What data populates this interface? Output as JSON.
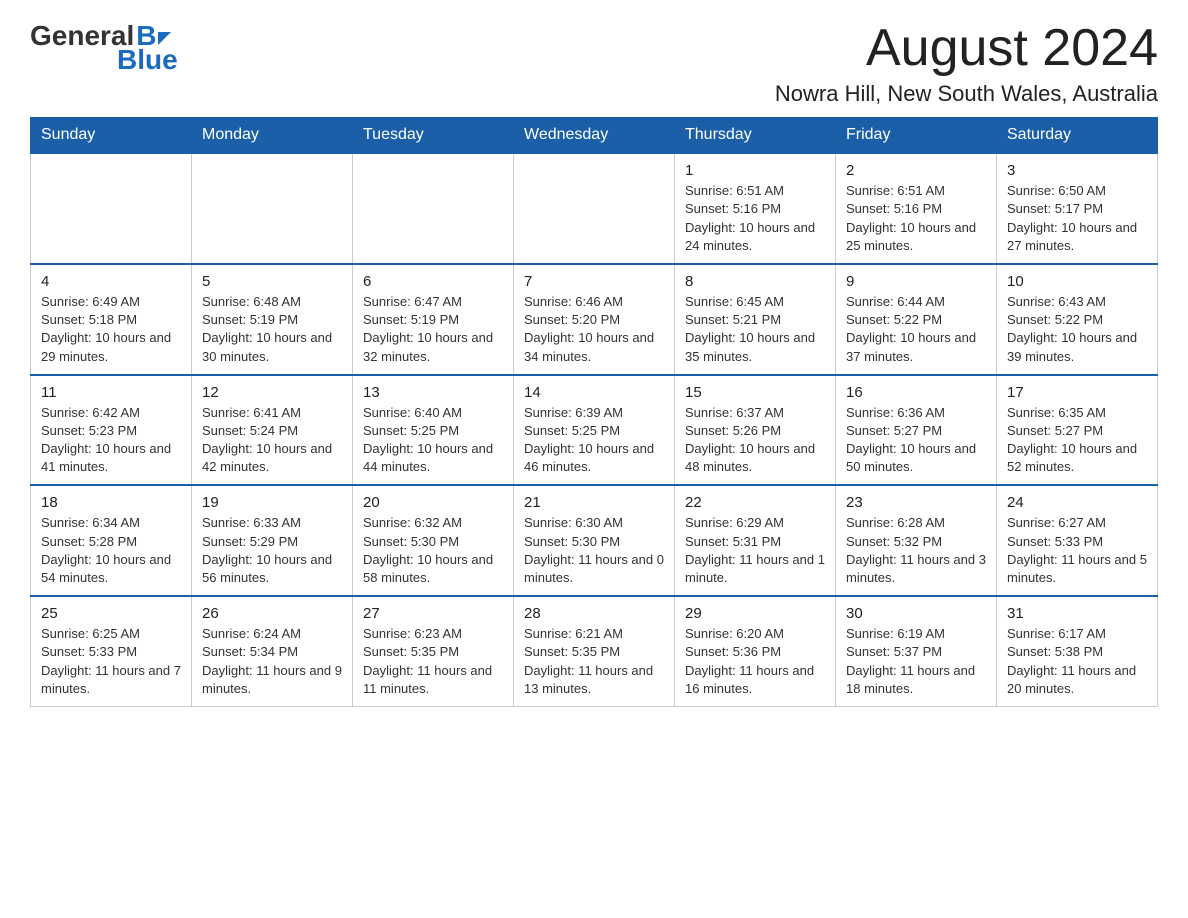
{
  "logo": {
    "general": "General",
    "blue": "Blue"
  },
  "header": {
    "month_year": "August 2024",
    "location": "Nowra Hill, New South Wales, Australia"
  },
  "days_of_week": [
    "Sunday",
    "Monday",
    "Tuesday",
    "Wednesday",
    "Thursday",
    "Friday",
    "Saturday"
  ],
  "weeks": [
    {
      "days": [
        {
          "date": "",
          "info": ""
        },
        {
          "date": "",
          "info": ""
        },
        {
          "date": "",
          "info": ""
        },
        {
          "date": "",
          "info": ""
        },
        {
          "date": "1",
          "info": "Sunrise: 6:51 AM\nSunset: 5:16 PM\nDaylight: 10 hours and 24 minutes."
        },
        {
          "date": "2",
          "info": "Sunrise: 6:51 AM\nSunset: 5:16 PM\nDaylight: 10 hours and 25 minutes."
        },
        {
          "date": "3",
          "info": "Sunrise: 6:50 AM\nSunset: 5:17 PM\nDaylight: 10 hours and 27 minutes."
        }
      ]
    },
    {
      "days": [
        {
          "date": "4",
          "info": "Sunrise: 6:49 AM\nSunset: 5:18 PM\nDaylight: 10 hours and 29 minutes."
        },
        {
          "date": "5",
          "info": "Sunrise: 6:48 AM\nSunset: 5:19 PM\nDaylight: 10 hours and 30 minutes."
        },
        {
          "date": "6",
          "info": "Sunrise: 6:47 AM\nSunset: 5:19 PM\nDaylight: 10 hours and 32 minutes."
        },
        {
          "date": "7",
          "info": "Sunrise: 6:46 AM\nSunset: 5:20 PM\nDaylight: 10 hours and 34 minutes."
        },
        {
          "date": "8",
          "info": "Sunrise: 6:45 AM\nSunset: 5:21 PM\nDaylight: 10 hours and 35 minutes."
        },
        {
          "date": "9",
          "info": "Sunrise: 6:44 AM\nSunset: 5:22 PM\nDaylight: 10 hours and 37 minutes."
        },
        {
          "date": "10",
          "info": "Sunrise: 6:43 AM\nSunset: 5:22 PM\nDaylight: 10 hours and 39 minutes."
        }
      ]
    },
    {
      "days": [
        {
          "date": "11",
          "info": "Sunrise: 6:42 AM\nSunset: 5:23 PM\nDaylight: 10 hours and 41 minutes."
        },
        {
          "date": "12",
          "info": "Sunrise: 6:41 AM\nSunset: 5:24 PM\nDaylight: 10 hours and 42 minutes."
        },
        {
          "date": "13",
          "info": "Sunrise: 6:40 AM\nSunset: 5:25 PM\nDaylight: 10 hours and 44 minutes."
        },
        {
          "date": "14",
          "info": "Sunrise: 6:39 AM\nSunset: 5:25 PM\nDaylight: 10 hours and 46 minutes."
        },
        {
          "date": "15",
          "info": "Sunrise: 6:37 AM\nSunset: 5:26 PM\nDaylight: 10 hours and 48 minutes."
        },
        {
          "date": "16",
          "info": "Sunrise: 6:36 AM\nSunset: 5:27 PM\nDaylight: 10 hours and 50 minutes."
        },
        {
          "date": "17",
          "info": "Sunrise: 6:35 AM\nSunset: 5:27 PM\nDaylight: 10 hours and 52 minutes."
        }
      ]
    },
    {
      "days": [
        {
          "date": "18",
          "info": "Sunrise: 6:34 AM\nSunset: 5:28 PM\nDaylight: 10 hours and 54 minutes."
        },
        {
          "date": "19",
          "info": "Sunrise: 6:33 AM\nSunset: 5:29 PM\nDaylight: 10 hours and 56 minutes."
        },
        {
          "date": "20",
          "info": "Sunrise: 6:32 AM\nSunset: 5:30 PM\nDaylight: 10 hours and 58 minutes."
        },
        {
          "date": "21",
          "info": "Sunrise: 6:30 AM\nSunset: 5:30 PM\nDaylight: 11 hours and 0 minutes."
        },
        {
          "date": "22",
          "info": "Sunrise: 6:29 AM\nSunset: 5:31 PM\nDaylight: 11 hours and 1 minute."
        },
        {
          "date": "23",
          "info": "Sunrise: 6:28 AM\nSunset: 5:32 PM\nDaylight: 11 hours and 3 minutes."
        },
        {
          "date": "24",
          "info": "Sunrise: 6:27 AM\nSunset: 5:33 PM\nDaylight: 11 hours and 5 minutes."
        }
      ]
    },
    {
      "days": [
        {
          "date": "25",
          "info": "Sunrise: 6:25 AM\nSunset: 5:33 PM\nDaylight: 11 hours and 7 minutes."
        },
        {
          "date": "26",
          "info": "Sunrise: 6:24 AM\nSunset: 5:34 PM\nDaylight: 11 hours and 9 minutes."
        },
        {
          "date": "27",
          "info": "Sunrise: 6:23 AM\nSunset: 5:35 PM\nDaylight: 11 hours and 11 minutes."
        },
        {
          "date": "28",
          "info": "Sunrise: 6:21 AM\nSunset: 5:35 PM\nDaylight: 11 hours and 13 minutes."
        },
        {
          "date": "29",
          "info": "Sunrise: 6:20 AM\nSunset: 5:36 PM\nDaylight: 11 hours and 16 minutes."
        },
        {
          "date": "30",
          "info": "Sunrise: 6:19 AM\nSunset: 5:37 PM\nDaylight: 11 hours and 18 minutes."
        },
        {
          "date": "31",
          "info": "Sunrise: 6:17 AM\nSunset: 5:38 PM\nDaylight: 11 hours and 20 minutes."
        }
      ]
    }
  ]
}
